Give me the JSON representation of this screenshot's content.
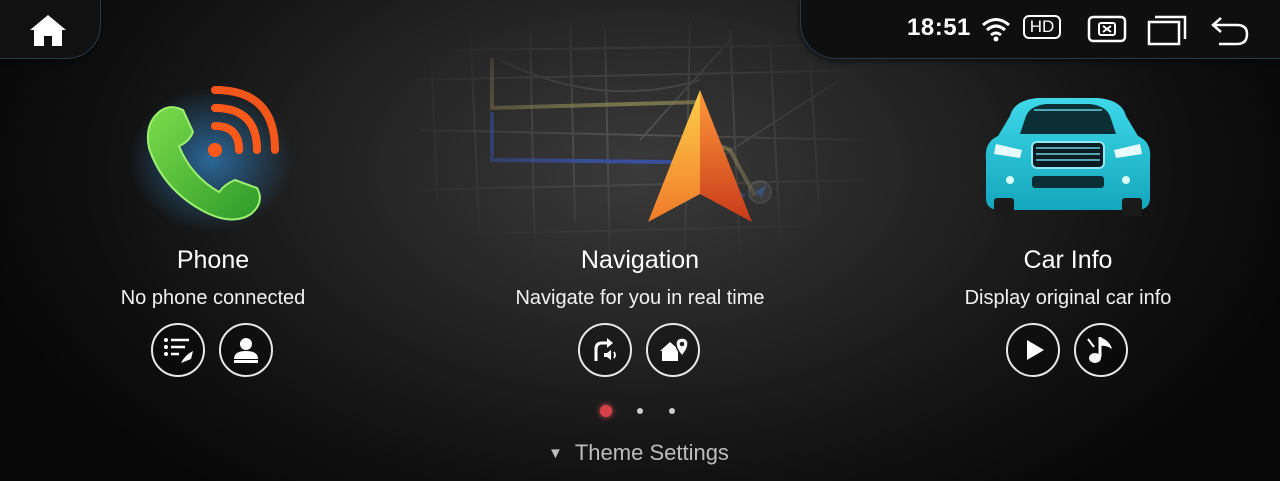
{
  "status_bar": {
    "time": "18:51",
    "hd_badge": "HD",
    "icons": [
      "home-icon",
      "wifi-icon",
      "close-app-icon",
      "windows-icon",
      "back-icon"
    ]
  },
  "cards": [
    {
      "title": "Phone",
      "subtitle": "No phone connected",
      "icon": "phone-icon",
      "buttons": [
        "call-log-icon",
        "contacts-icon"
      ]
    },
    {
      "title": "Navigation",
      "subtitle": "Navigate for you in real time",
      "icon": "navigation-arrow-icon",
      "buttons": [
        "voice-guidance-icon",
        "home-location-icon"
      ]
    },
    {
      "title": "Car Info",
      "subtitle": "Display original car info",
      "icon": "car-icon",
      "buttons": [
        "play-icon",
        "music-icon"
      ]
    }
  ],
  "pager": {
    "pages": 3,
    "active_page": 1
  },
  "theme_settings": {
    "label": "Theme Settings"
  },
  "colors": {
    "accent_red": "#d8404a",
    "phone_green": "#4cc040",
    "signal_orange": "#ff5a1a",
    "nav_orange": "#f07a2a",
    "car_cyan": "#22c6dc",
    "route_blue": "#3a56b8",
    "route_khaki": "#8c8456"
  }
}
